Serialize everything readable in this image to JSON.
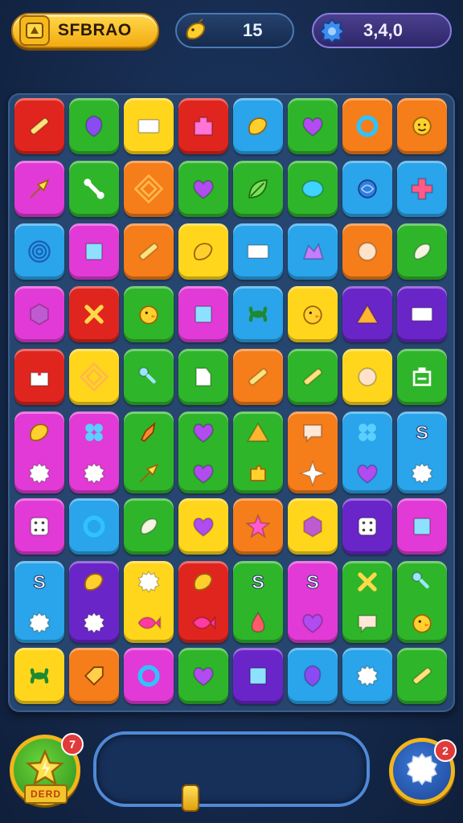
{
  "hud": {
    "score_label": "SFBRAO",
    "moves_value": "15",
    "coins_value": "3,4,0",
    "score_icon": "star-box-icon",
    "moves_icon": "lemon-icon",
    "coins_icon": "gem-gear-icon"
  },
  "colors": {
    "red": "#e0251f",
    "green": "#2fb52a",
    "yellow": "#ffd61c",
    "blue": "#2aa4ea",
    "orange": "#f57d1a",
    "magenta": "#e23ad6",
    "purple": "#6a25c9"
  },
  "board": {
    "columns": 8,
    "rows": [
      [
        {
          "color": "red",
          "icon": "stick-icon"
        },
        {
          "color": "green",
          "icon": "shield-icon"
        },
        {
          "color": "yellow",
          "icon": "rectangle-icon"
        },
        {
          "color": "red",
          "icon": "house-block-icon"
        },
        {
          "color": "blue",
          "icon": "lemon-icon"
        },
        {
          "color": "green",
          "icon": "heart-icon"
        },
        {
          "color": "orange",
          "icon": "ring-icon"
        },
        {
          "color": "orange",
          "icon": "sun-face-icon"
        }
      ],
      [
        {
          "color": "magenta",
          "icon": "arrow-icon"
        },
        {
          "color": "green",
          "icon": "bone-icon"
        },
        {
          "color": "orange",
          "icon": "spiral-square-icon"
        },
        {
          "color": "green",
          "icon": "heart-icon"
        },
        {
          "color": "green",
          "icon": "leaf-icon"
        },
        {
          "color": "green",
          "icon": "oval-icon"
        },
        {
          "color": "blue",
          "icon": "flower-icon"
        },
        {
          "color": "blue",
          "icon": "cross-icon"
        }
      ],
      [
        {
          "color": "blue",
          "icon": "spiral-icon"
        },
        {
          "color": "magenta",
          "icon": "square-icon"
        },
        {
          "color": "orange",
          "icon": "stick-icon"
        },
        {
          "color": "yellow",
          "icon": "lemon-icon"
        },
        {
          "color": "blue",
          "icon": "rectangle-icon"
        },
        {
          "color": "blue",
          "icon": "hat-icon"
        },
        {
          "color": "orange",
          "icon": "circle-icon"
        },
        {
          "color": "green",
          "icon": "bean-icon"
        }
      ],
      [
        {
          "color": "magenta",
          "icon": "hexagon-icon"
        },
        {
          "color": "red",
          "icon": "cross-x-icon"
        },
        {
          "color": "green",
          "icon": "chick-icon"
        },
        {
          "color": "magenta",
          "icon": "square-icon"
        },
        {
          "color": "blue",
          "icon": "knot-icon"
        },
        {
          "color": "yellow",
          "icon": "chick-icon"
        },
        {
          "color": "purple",
          "icon": "tent-icon"
        },
        {
          "color": "purple",
          "icon": "rectangle-icon"
        }
      ],
      [
        {
          "color": "red",
          "icon": "gift-icon"
        },
        {
          "color": "yellow",
          "icon": "spiral-square-icon"
        },
        {
          "color": "green",
          "icon": "key-icon"
        },
        {
          "color": "green",
          "icon": "flag-icon"
        },
        {
          "color": "orange",
          "icon": "stick-icon"
        },
        {
          "color": "green",
          "icon": "stick-icon"
        },
        {
          "color": "yellow",
          "icon": "circle-icon"
        },
        {
          "color": "green",
          "icon": "box-icon"
        }
      ]
    ],
    "tall_rows": [
      [
        {
          "color": "magenta",
          "icons": [
            "lemon-icon",
            "gear-icon"
          ]
        },
        {
          "color": "magenta",
          "icons": [
            "clover-icon",
            "gear-icon"
          ]
        },
        {
          "color": "green",
          "icons": [
            "rocket-icon",
            "arrow-icon"
          ]
        },
        {
          "color": "green",
          "icons": [
            "heart-icon",
            "heart-icon"
          ]
        },
        {
          "color": "green",
          "icons": [
            "tent-icon",
            "puzzle-icon"
          ]
        },
        {
          "color": "orange",
          "icons": [
            "speech-icon",
            "star4-icon"
          ]
        },
        {
          "color": "blue",
          "icons": [
            "clover-icon",
            "heart-icon"
          ]
        },
        {
          "color": "blue",
          "icons": [
            "letter-s-icon",
            "gear-icon"
          ]
        }
      ]
    ],
    "rows_b": [
      [
        {
          "color": "magenta",
          "icon": "dice-icon"
        },
        {
          "color": "blue",
          "icon": "ring-icon"
        },
        {
          "color": "green",
          "icon": "bean-icon"
        },
        {
          "color": "yellow",
          "icon": "heart-icon"
        },
        {
          "color": "orange",
          "icon": "star-icon"
        },
        {
          "color": "yellow",
          "icon": "hexagon-icon"
        },
        {
          "color": "purple",
          "icon": "dice-icon"
        },
        {
          "color": "magenta",
          "icon": "square-icon"
        }
      ]
    ],
    "tall_rows_b": [
      [
        {
          "color": "blue",
          "icons": [
            "letter-s-icon",
            "gear-icon"
          ]
        },
        {
          "color": "purple",
          "icons": [
            "lemon-icon",
            "gear-icon"
          ]
        },
        {
          "color": "yellow",
          "icons": [
            "gear-icon",
            "fish-icon"
          ]
        },
        {
          "color": "red",
          "icons": [
            "lemon-icon",
            "fish-icon"
          ]
        },
        {
          "color": "green",
          "icons": [
            "letter-s-icon",
            "drop-icon"
          ]
        },
        {
          "color": "magenta",
          "icons": [
            "letter-s-icon",
            "heart-icon"
          ]
        },
        {
          "color": "green",
          "icons": [
            "cross-x-icon",
            "speech-icon"
          ]
        },
        {
          "color": "green",
          "icons": [
            "key-icon",
            "chick-icon"
          ]
        }
      ]
    ],
    "rows_c": [
      [
        {
          "color": "yellow",
          "icon": "knot-icon"
        },
        {
          "color": "orange",
          "icon": "tag-icon"
        },
        {
          "color": "magenta",
          "icon": "ring-icon"
        },
        {
          "color": "green",
          "icon": "heart-icon"
        },
        {
          "color": "purple",
          "icon": "square-icon"
        },
        {
          "color": "blue",
          "icon": "shield-icon"
        },
        {
          "color": "blue",
          "icon": "gear-icon"
        },
        {
          "color": "green",
          "icon": "stick-icon"
        }
      ]
    ]
  },
  "bottom": {
    "left_booster_badge": "7",
    "left_booster_label": "DERD",
    "left_booster_icon": "star-bolt-icon",
    "right_booster_badge": "2",
    "right_booster_icon": "gear-icon",
    "progress": 0.0
  }
}
